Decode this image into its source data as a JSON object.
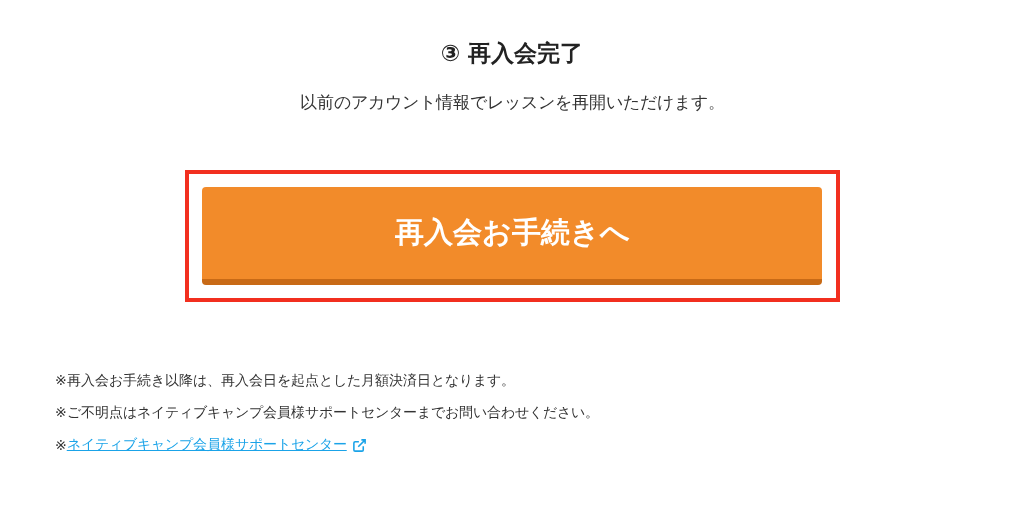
{
  "heading": "③ 再入会完了",
  "subtitle": "以前のアカウント情報でレッスンを再開いただけます。",
  "highlighted": true,
  "button": {
    "label": "再入会お手続きへ"
  },
  "notes": [
    {
      "kind": "text",
      "text": "※再入会お手続き以降は、再入会日を起点とした月額決済日となります。"
    },
    {
      "kind": "text",
      "text": "※ご不明点はネイティブキャンプ会員様サポートセンターまでお問い合わせください。"
    },
    {
      "kind": "link",
      "prefix": "※",
      "text": "ネイティブキャンプ会員様サポートセンター"
    }
  ]
}
